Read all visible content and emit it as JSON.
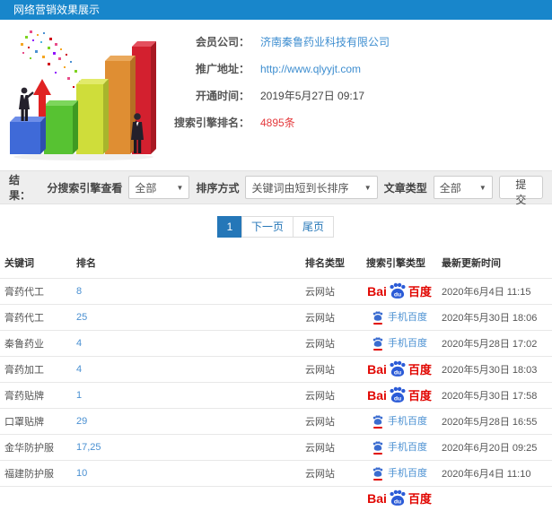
{
  "header": {
    "title": "网络营销效果展示",
    "bg_color": "#1886cb"
  },
  "info": {
    "fields": [
      {
        "label": "会员公司：",
        "value": "济南秦鲁药业科技有限公司"
      },
      {
        "label": "推广地址：",
        "value": "http://www.qlyyjt.com"
      },
      {
        "label": "开通时间：",
        "value": "2019年5月27日 09:17"
      },
      {
        "label": "搜索引擎排名：",
        "value": "4895条"
      }
    ],
    "highlight_color": "#e4393c",
    "link_color": "#3e8ed0"
  },
  "filters": {
    "result_label": "结果：",
    "engine_label": "分搜索引擎查看",
    "engine_value": "全部",
    "sort_label": "排序方式",
    "sort_value": "关键词由短到长排序",
    "article_label": "文章类型",
    "article_value": "全部",
    "submit_label": "提交",
    "caret": "▼"
  },
  "pagination": {
    "current": "1",
    "next_label": "下一页",
    "last_label": "尾页"
  },
  "engines": {
    "baidu_latin": "Bai",
    "baidu_du": "du",
    "baidu_cn": "百度",
    "mobile_label": "手机百度",
    "baidu_red": "#e10601",
    "paw_blue": "#2b5bd7"
  },
  "table": {
    "headers": [
      "关键词",
      "排名",
      "排名类型",
      "搜索引擎类型",
      "最新更新时间"
    ],
    "rows": [
      {
        "keyword": "膏药代工",
        "rank": "8",
        "rank_type": "云网站",
        "engine": "baidu",
        "updated": "2020年6月4日 11:15"
      },
      {
        "keyword": "膏药代工",
        "rank": "25",
        "rank_type": "云网站",
        "engine": "mobile",
        "updated": "2020年5月30日 18:06"
      },
      {
        "keyword": "秦鲁药业",
        "rank": "4",
        "rank_type": "云网站",
        "engine": "mobile",
        "updated": "2020年5月28日 17:02"
      },
      {
        "keyword": "膏药加工",
        "rank": "4",
        "rank_type": "云网站",
        "engine": "baidu",
        "updated": "2020年5月30日 18:03"
      },
      {
        "keyword": "膏药贴牌",
        "rank": "1",
        "rank_type": "云网站",
        "engine": "baidu",
        "updated": "2020年5月30日 17:58"
      },
      {
        "keyword": "口罩贴牌",
        "rank": "29",
        "rank_type": "云网站",
        "engine": "mobile",
        "updated": "2020年5月28日 16:55"
      },
      {
        "keyword": "金华防护服",
        "rank": "17,25",
        "rank_type": "云网站",
        "engine": "mobile",
        "updated": "2020年6月20日 09:25"
      },
      {
        "keyword": "福建防护服",
        "rank": "10",
        "rank_type": "云网站",
        "engine": "mobile",
        "updated": "2020年6月4日 11:10"
      },
      {
        "keyword": "",
        "rank": "",
        "rank_type": "",
        "engine": "baidu",
        "updated": ""
      }
    ]
  }
}
